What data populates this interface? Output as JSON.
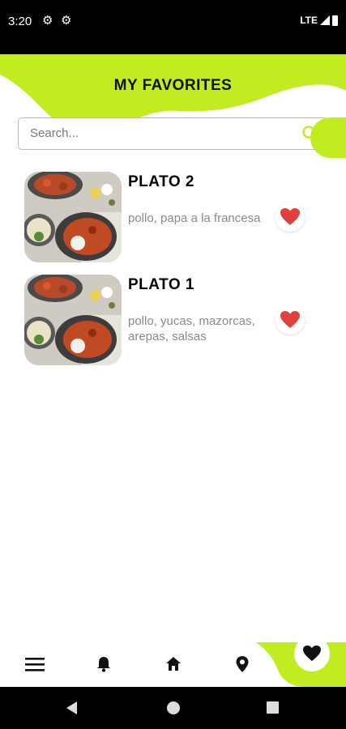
{
  "status_bar": {
    "time": "3:20",
    "network": "LTE"
  },
  "header": {
    "title": "MY FAVORITES"
  },
  "search": {
    "placeholder": "Search..."
  },
  "favorites": [
    {
      "title": "PLATO 2",
      "description": "pollo, papa a la francesa"
    },
    {
      "title": "PLATO 1",
      "description": "pollo, yucas, mazorcas, arepas, salsas"
    }
  ],
  "bottom_nav": {
    "items": [
      "menu-icon",
      "bell-icon",
      "home-icon",
      "location-pin-icon",
      "heart-icon"
    ],
    "active": "heart-icon"
  },
  "colors": {
    "accent": "#c1ec20",
    "heart": "#e0413c",
    "text": "#111111",
    "muted": "#8a8a8a"
  }
}
